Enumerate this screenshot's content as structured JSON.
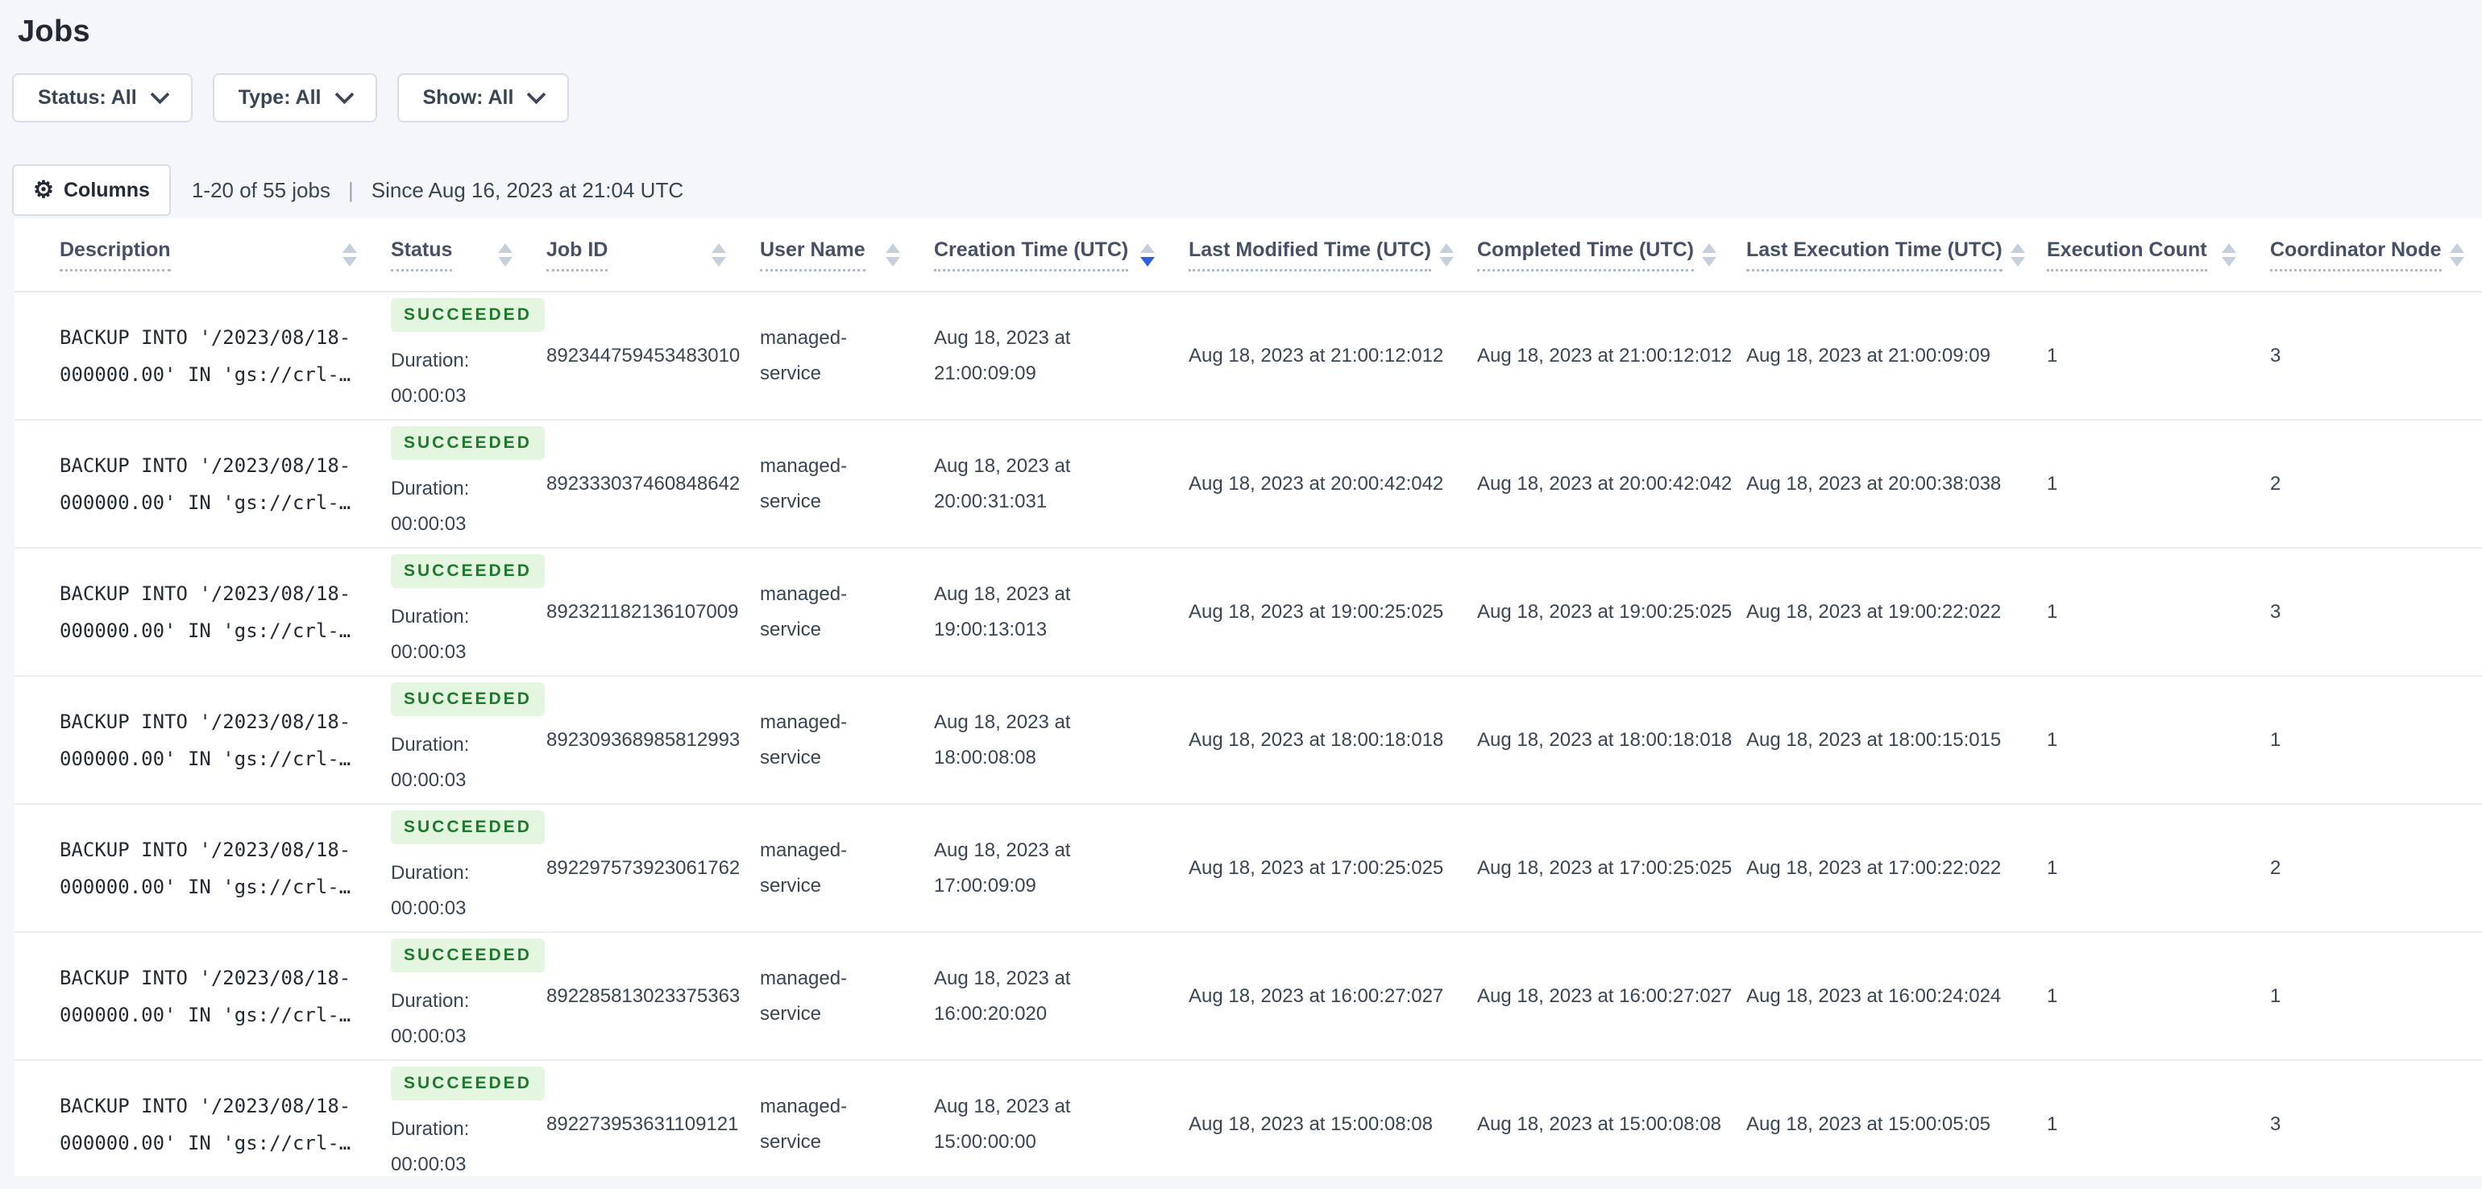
{
  "page": {
    "title": "Jobs"
  },
  "filters": [
    {
      "label": "Status: All"
    },
    {
      "label": "Type: All"
    },
    {
      "label": "Show: All"
    }
  ],
  "toolbar": {
    "columns_label": "Columns",
    "gear_icon": "⚙",
    "results_summary": "1-20 of 55 jobs",
    "separator": "|",
    "since_text": "Since Aug 16, 2023 at 21:04 UTC"
  },
  "table": {
    "columns": [
      {
        "label": "Description",
        "sort": "none"
      },
      {
        "label": "Status",
        "sort": "none"
      },
      {
        "label": "Job ID",
        "sort": "none"
      },
      {
        "label": "User Name",
        "sort": "none"
      },
      {
        "label": "Creation Time (UTC)",
        "sort": "desc"
      },
      {
        "label": "Last Modified Time (UTC)",
        "sort": "none"
      },
      {
        "label": "Completed Time (UTC)",
        "sort": "none"
      },
      {
        "label": "Last Execution Time (UTC)",
        "sort": "none"
      },
      {
        "label": "Execution Count",
        "sort": "none"
      },
      {
        "label": "Coordinator Node",
        "sort": "none"
      }
    ],
    "rows": [
      {
        "description": "BACKUP INTO '/2023/08/18-000000.00' IN 'gs://crl-…",
        "status": "SUCCEEDED",
        "duration": "Duration: 00:00:03",
        "job_id": "892344759453483010",
        "user_name": "managed-service",
        "creation_time": "Aug 18, 2023 at 21:00:09:09",
        "last_modified_time": "Aug 18, 2023 at 21:00:12:012",
        "completed_time": "Aug 18, 2023 at 21:00:12:012",
        "last_execution_time": "Aug 18, 2023 at 21:00:09:09",
        "execution_count": "1",
        "coordinator_node": "3"
      },
      {
        "description": "BACKUP INTO '/2023/08/18-000000.00' IN 'gs://crl-…",
        "status": "SUCCEEDED",
        "duration": "Duration: 00:00:03",
        "job_id": "892333037460848642",
        "user_name": "managed-service",
        "creation_time": "Aug 18, 2023 at 20:00:31:031",
        "last_modified_time": "Aug 18, 2023 at 20:00:42:042",
        "completed_time": "Aug 18, 2023 at 20:00:42:042",
        "last_execution_time": "Aug 18, 2023 at 20:00:38:038",
        "execution_count": "1",
        "coordinator_node": "2"
      },
      {
        "description": "BACKUP INTO '/2023/08/18-000000.00' IN 'gs://crl-…",
        "status": "SUCCEEDED",
        "duration": "Duration: 00:00:03",
        "job_id": "892321182136107009",
        "user_name": "managed-service",
        "creation_time": "Aug 18, 2023 at 19:00:13:013",
        "last_modified_time": "Aug 18, 2023 at 19:00:25:025",
        "completed_time": "Aug 18, 2023 at 19:00:25:025",
        "last_execution_time": "Aug 18, 2023 at 19:00:22:022",
        "execution_count": "1",
        "coordinator_node": "3"
      },
      {
        "description": "BACKUP INTO '/2023/08/18-000000.00' IN 'gs://crl-…",
        "status": "SUCCEEDED",
        "duration": "Duration: 00:00:03",
        "job_id": "892309368985812993",
        "user_name": "managed-service",
        "creation_time": "Aug 18, 2023 at 18:00:08:08",
        "last_modified_time": "Aug 18, 2023 at 18:00:18:018",
        "completed_time": "Aug 18, 2023 at 18:00:18:018",
        "last_execution_time": "Aug 18, 2023 at 18:00:15:015",
        "execution_count": "1",
        "coordinator_node": "1"
      },
      {
        "description": "BACKUP INTO '/2023/08/18-000000.00' IN 'gs://crl-…",
        "status": "SUCCEEDED",
        "duration": "Duration: 00:00:03",
        "job_id": "892297573923061762",
        "user_name": "managed-service",
        "creation_time": "Aug 18, 2023 at 17:00:09:09",
        "last_modified_time": "Aug 18, 2023 at 17:00:25:025",
        "completed_time": "Aug 18, 2023 at 17:00:25:025",
        "last_execution_time": "Aug 18, 2023 at 17:00:22:022",
        "execution_count": "1",
        "coordinator_node": "2"
      },
      {
        "description": "BACKUP INTO '/2023/08/18-000000.00' IN 'gs://crl-…",
        "status": "SUCCEEDED",
        "duration": "Duration: 00:00:03",
        "job_id": "892285813023375363",
        "user_name": "managed-service",
        "creation_time": "Aug 18, 2023 at 16:00:20:020",
        "last_modified_time": "Aug 18, 2023 at 16:00:27:027",
        "completed_time": "Aug 18, 2023 at 16:00:27:027",
        "last_execution_time": "Aug 18, 2023 at 16:00:24:024",
        "execution_count": "1",
        "coordinator_node": "1"
      },
      {
        "description": "BACKUP INTO '/2023/08/18-000000.00' IN 'gs://crl-…",
        "status": "SUCCEEDED",
        "duration": "Duration: 00:00:03",
        "job_id": "892273953631109121",
        "user_name": "managed-service",
        "creation_time": "Aug 18, 2023 at 15:00:00:00",
        "last_modified_time": "Aug 18, 2023 at 15:00:08:08",
        "completed_time": "Aug 18, 2023 at 15:00:08:08",
        "last_execution_time": "Aug 18, 2023 at 15:00:05:05",
        "execution_count": "1",
        "coordinator_node": "3"
      }
    ]
  },
  "colors": {
    "page_bg": "#f4f6fa",
    "sort_active": "#2f5fe0",
    "badge_bg": "#e4f5e0",
    "badge_text": "#1d7a2c"
  }
}
